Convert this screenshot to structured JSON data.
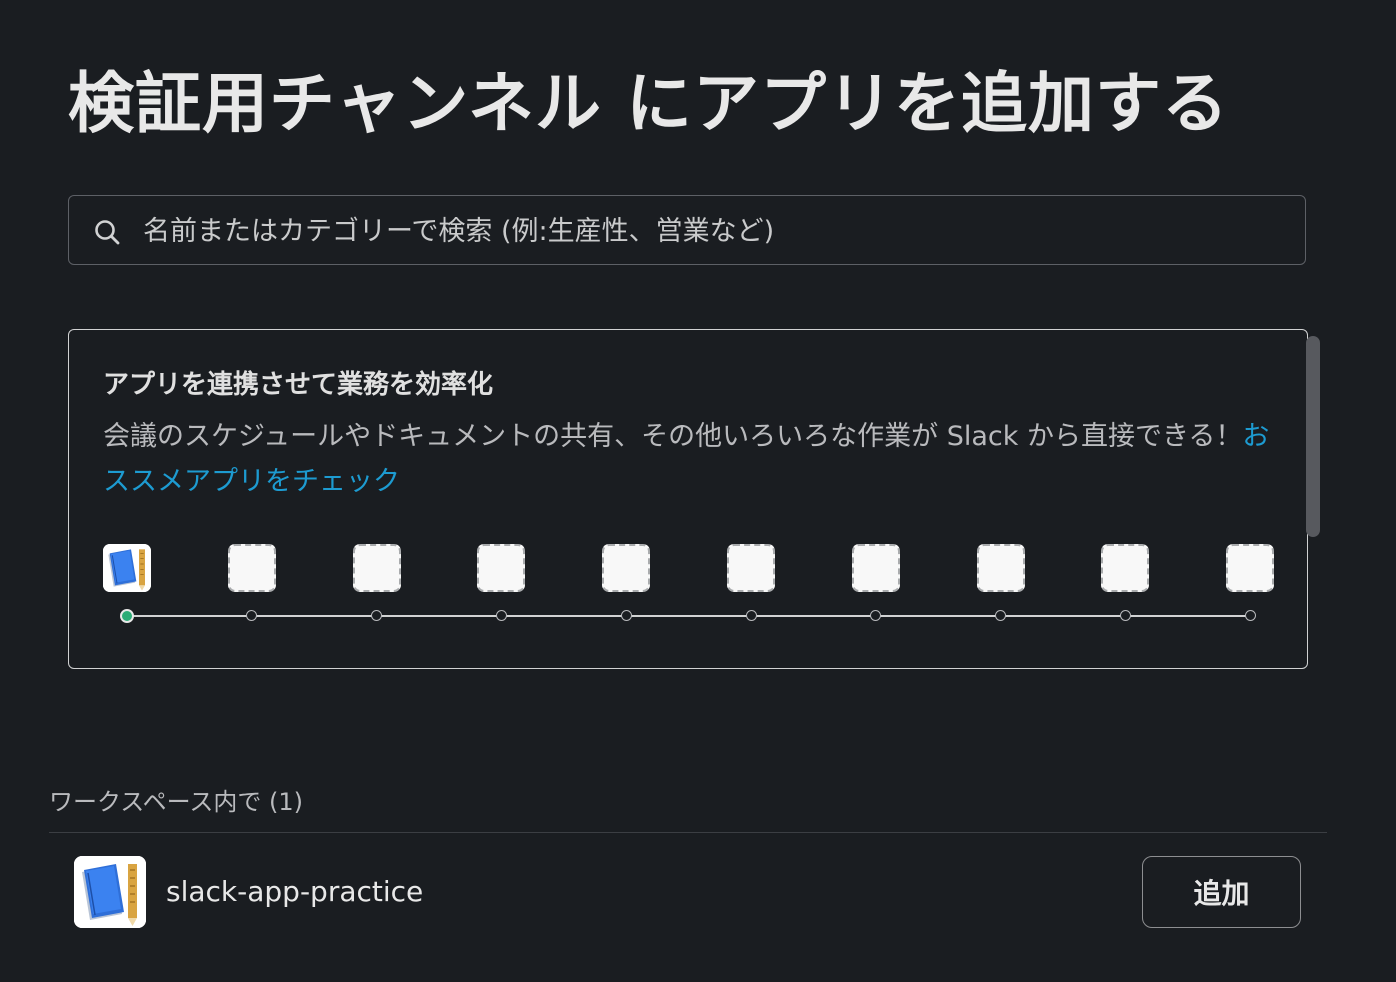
{
  "title": "検証用チャンネル にアプリを追加する",
  "search": {
    "placeholder": "名前またはカテゴリーで検索 (例:生産性、営業など)",
    "icon": "search-icon"
  },
  "promo": {
    "heading": "アプリを連携させて業務を効率化",
    "description": "会議のスケジュールやドキュメントの共有、その他いろいろな作業が Slack から直接できる！",
    "link_text": "おススメアプリをチェック",
    "slots_filled": 1,
    "slots_total": 10
  },
  "workspace_section": {
    "label": "ワークスペース内で (1)"
  },
  "apps": [
    {
      "name": "slack-app-practice",
      "icon": "notebook-app-icon",
      "button_label": "追加"
    }
  ],
  "colors": {
    "background": "#1a1d21",
    "link": "#1d9bd1",
    "active_dot": "#2bac76"
  }
}
